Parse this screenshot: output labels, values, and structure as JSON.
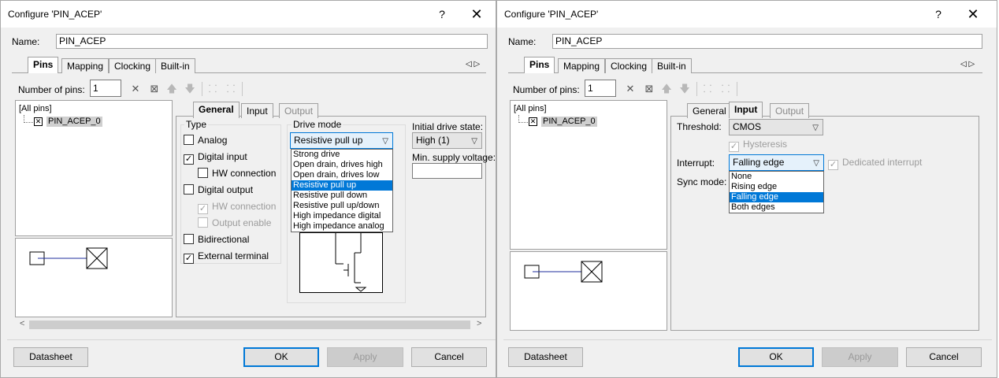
{
  "left": {
    "title": "Configure 'PIN_ACEP'",
    "help": "?",
    "close": "✕",
    "name_label": "Name:",
    "name_value": "PIN_ACEP",
    "tabs": [
      "Pins",
      "Mapping",
      "Clocking",
      "Built-in"
    ],
    "nav_arrows": "◁ ▷",
    "num_pins_label": "Number of pins:",
    "num_pins_value": "1",
    "tree_root": "[All pins]",
    "tree_pin": "PIN_ACEP_0",
    "subtabs": [
      "General",
      "Input",
      "Output"
    ],
    "type_title": "Type",
    "type_options": [
      {
        "label": "Analog",
        "checked": false,
        "enabled": true
      },
      {
        "label": "Digital input",
        "checked": true,
        "enabled": true
      },
      {
        "label": "HW connection",
        "checked": false,
        "enabled": true
      },
      {
        "label": "Digital output",
        "checked": false,
        "enabled": true
      },
      {
        "label": "HW connection",
        "checked": true,
        "enabled": false
      },
      {
        "label": "Output enable",
        "checked": false,
        "enabled": false
      },
      {
        "label": "Bidirectional",
        "checked": false,
        "enabled": true
      },
      {
        "label": "External terminal",
        "checked": true,
        "enabled": true
      }
    ],
    "drive_mode_title": "Drive mode",
    "drive_mode_value": "Resistive pull up",
    "drive_mode_options": [
      "Strong drive",
      "Open drain, drives high",
      "Open drain, drives low",
      "Resistive pull up",
      "Resistive pull down",
      "Resistive pull up/down",
      "High impedance digital",
      "High impedance analog"
    ],
    "drive_mode_selected_index": 3,
    "init_drive_label": "Initial drive state:",
    "init_drive_value": "High (1)",
    "min_supply_label": "Min. supply voltage:",
    "min_supply_value": "",
    "buttons": {
      "datasheet": "Datasheet",
      "ok": "OK",
      "apply": "Apply",
      "cancel": "Cancel"
    }
  },
  "right": {
    "title": "Configure 'PIN_ACEP'",
    "help": "?",
    "close": "✕",
    "name_label": "Name:",
    "name_value": "PIN_ACEP",
    "tabs": [
      "Pins",
      "Mapping",
      "Clocking",
      "Built-in"
    ],
    "nav_arrows": "◁ ▷",
    "num_pins_label": "Number of pins:",
    "num_pins_value": "1",
    "tree_root": "[All pins]",
    "tree_pin": "PIN_ACEP_0",
    "subtabs": [
      "General",
      "Input",
      "Output"
    ],
    "threshold_label": "Threshold:",
    "threshold_value": "CMOS",
    "hysteresis_label": "Hysteresis",
    "interrupt_label": "Interrupt:",
    "interrupt_value": "Falling edge",
    "interrupt_options": [
      "None",
      "Rising edge",
      "Falling edge",
      "Both edges"
    ],
    "interrupt_selected_index": 2,
    "dedicated_interrupt_label": "Dedicated interrupt",
    "sync_mode_label": "Sync mode:",
    "buttons": {
      "datasheet": "Datasheet",
      "ok": "OK",
      "apply": "Apply",
      "cancel": "Cancel"
    }
  },
  "icons": {
    "delete": "✕",
    "select": "⊠",
    "up": "🡅",
    "down": "🡇",
    "check": "✓",
    "chevron": "⌵",
    "scroll_left": "<",
    "scroll_right": ">"
  }
}
